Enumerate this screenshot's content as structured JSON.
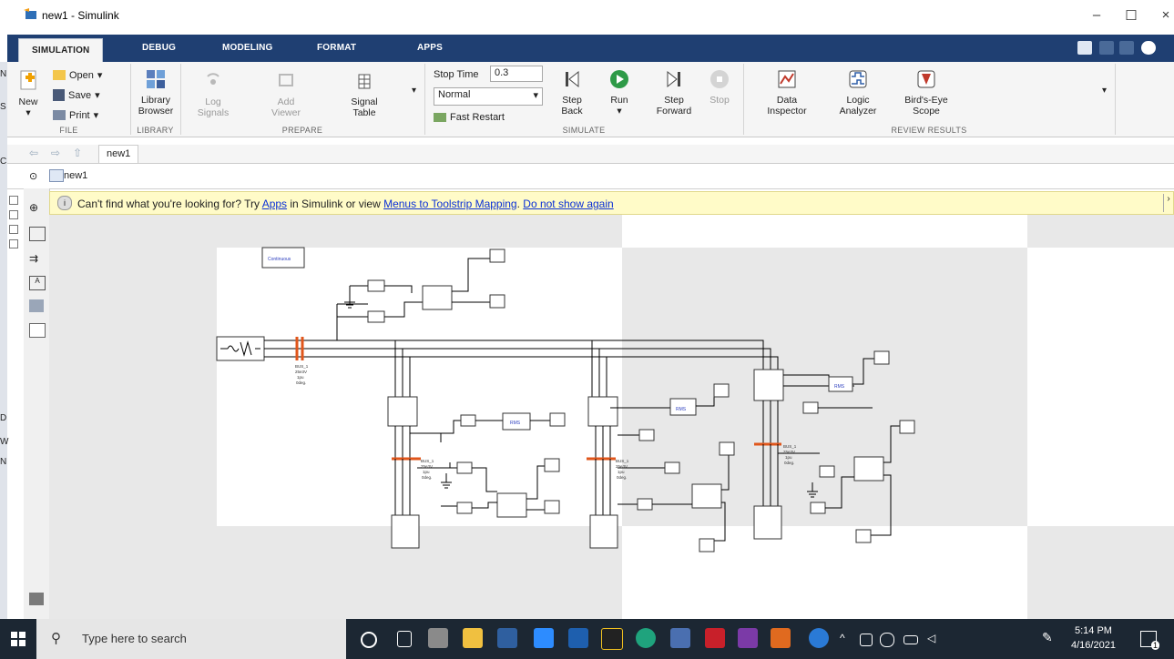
{
  "window": {
    "title": "new1 - Simulink",
    "minimize": "–",
    "maximize": "☐",
    "close": "×"
  },
  "tabs": [
    "SIMULATION",
    "DEBUG",
    "MODELING",
    "FORMAT",
    "APPS"
  ],
  "ribbon": {
    "file": {
      "group": "FILE",
      "new": "New",
      "open": "Open",
      "save": "Save",
      "print": "Print"
    },
    "library": {
      "group": "LIBRARY",
      "button_line1": "Library",
      "button_line2": "Browser"
    },
    "prepare": {
      "group": "PREPARE",
      "log_line1": "Log",
      "log_line2": "Signals",
      "add_line1": "Add",
      "add_line2": "Viewer",
      "sig_line1": "Signal",
      "sig_line2": "Table"
    },
    "simulate": {
      "group": "SIMULATE",
      "stop_time_label": "Stop Time",
      "stop_time_value": "0.3",
      "mode": "Normal",
      "fast_restart": "Fast Restart",
      "step_back_line1": "Step",
      "step_back_line2": "Back",
      "run": "Run",
      "step_fwd_line1": "Step",
      "step_fwd_line2": "Forward",
      "stop": "Stop"
    },
    "review": {
      "group": "REVIEW RESULTS",
      "data_line1": "Data",
      "data_line2": "Inspector",
      "logic_line1": "Logic",
      "logic_line2": "Analyzer",
      "birds_line1": "Bird's-Eye",
      "birds_line2": "Scope"
    }
  },
  "address": {
    "tab": "new1"
  },
  "breadcrumb": {
    "model": "new1"
  },
  "notification": {
    "text1": "Can't find what you're looking for? Try ",
    "link_apps": "Apps",
    "text2": " in Simulink or view ",
    "link_menus": "Menus to Toolstrip Mapping",
    "text3": ". ",
    "link_dismiss": "Do not show again"
  },
  "diagram": {
    "powergui": "Continuous",
    "rms_label": "RMS",
    "bus_label_line1": "BUS_1",
    "bus_label_line2": "25e3V",
    "bus_label_line3": "1pu",
    "bus_label_line4": "0deg."
  },
  "left_letters": [
    "N",
    "S",
    "C",
    "D",
    "W",
    "N"
  ],
  "taskbar": {
    "search_placeholder": "Type here to search",
    "time": "5:14 PM",
    "date": "4/16/2021",
    "notif_count": "1"
  }
}
